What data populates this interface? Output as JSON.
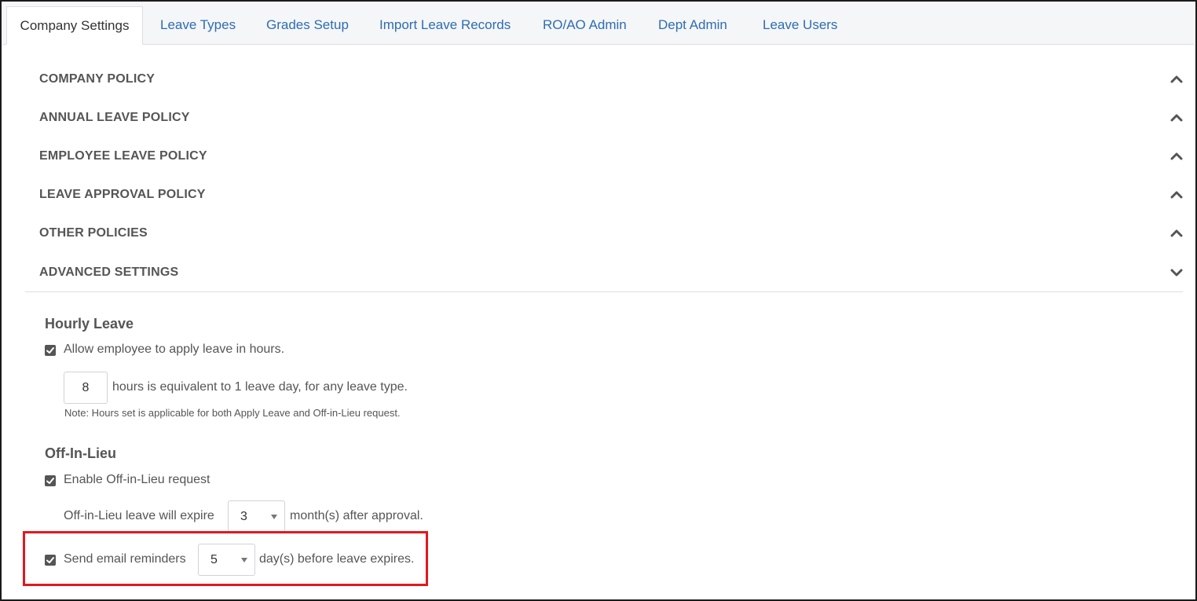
{
  "tabs": [
    {
      "label": "Company Settings",
      "active": true
    },
    {
      "label": "Leave Types",
      "active": false
    },
    {
      "label": "Grades Setup",
      "active": false
    },
    {
      "label": "Import Leave Records",
      "active": false
    },
    {
      "label": "RO/AO Admin",
      "active": false
    },
    {
      "label": "Dept Admin",
      "active": false
    },
    {
      "label": "Leave Users",
      "active": false
    }
  ],
  "accordion": [
    {
      "title": "COMPANY POLICY",
      "state": "collapsed",
      "icon": "chevron-up-icon"
    },
    {
      "title": "ANNUAL LEAVE POLICY",
      "state": "collapsed",
      "icon": "chevron-up-icon"
    },
    {
      "title": "EMPLOYEE LEAVE POLICY",
      "state": "collapsed",
      "icon": "chevron-up-icon"
    },
    {
      "title": "LEAVE APPROVAL POLICY",
      "state": "collapsed",
      "icon": "chevron-up-icon"
    },
    {
      "title": "OTHER POLICIES",
      "state": "collapsed",
      "icon": "chevron-up-icon"
    },
    {
      "title": "ADVANCED SETTINGS",
      "state": "expanded",
      "icon": "chevron-down-icon"
    }
  ],
  "hourly": {
    "title": "Hourly Leave",
    "allow_label": "Allow employee to apply leave in hours.",
    "allow_checked": true,
    "hours_value": "8",
    "hours_suffix": "hours is equivalent to 1 leave day, for any leave type.",
    "note": "Note: Hours set is applicable for both Apply Leave and Off-in-Lieu request."
  },
  "offinlieu": {
    "title": "Off-In-Lieu",
    "enable_label": "Enable Off-in-Lieu request",
    "enable_checked": true,
    "expire_prefix": "Off-in-Lieu leave will expire",
    "expire_value": "3",
    "expire_suffix": "month(s) after approval.",
    "reminder_label": "Send email reminders",
    "reminder_checked": true,
    "reminder_value": "5",
    "reminder_suffix": "day(s) before leave expires."
  },
  "colors": {
    "link": "#2f6db0",
    "text": "#555555",
    "highlight": "#e0191f"
  }
}
